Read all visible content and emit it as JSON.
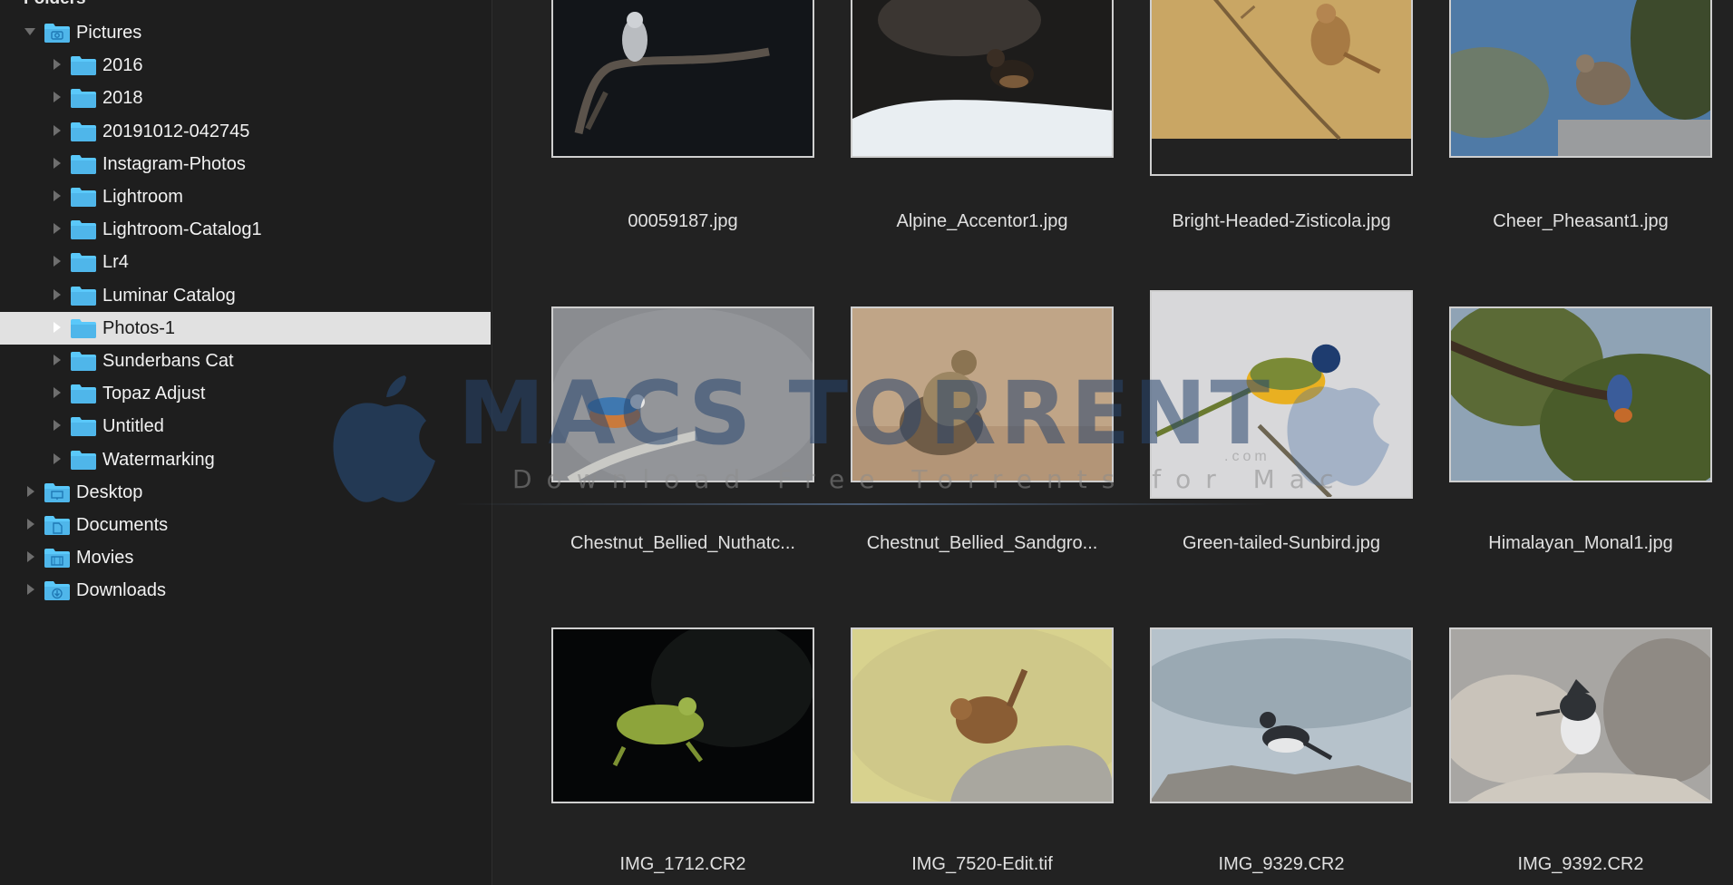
{
  "sidebar": {
    "section_title": "Folders",
    "tree": [
      {
        "label": "Pictures",
        "level": 0,
        "expanded": true,
        "icon": "pictures-folder-icon"
      },
      {
        "label": "2016",
        "level": 1,
        "icon": "folder-icon"
      },
      {
        "label": "2018",
        "level": 1,
        "icon": "folder-icon"
      },
      {
        "label": "20191012-042745",
        "level": 1,
        "icon": "folder-icon"
      },
      {
        "label": "Instagram-Photos",
        "level": 1,
        "icon": "folder-icon"
      },
      {
        "label": "Lightroom",
        "level": 1,
        "icon": "folder-icon"
      },
      {
        "label": "Lightroom-Catalog1",
        "level": 1,
        "icon": "folder-icon"
      },
      {
        "label": "Lr4",
        "level": 1,
        "icon": "folder-icon"
      },
      {
        "label": "Luminar Catalog",
        "level": 1,
        "icon": "folder-icon"
      },
      {
        "label": "Photos-1",
        "level": 1,
        "selected": true,
        "icon": "folder-icon"
      },
      {
        "label": "Sunderbans Cat",
        "level": 1,
        "icon": "folder-icon"
      },
      {
        "label": "Topaz Adjust",
        "level": 1,
        "icon": "folder-icon"
      },
      {
        "label": "Untitled",
        "level": 1,
        "icon": "folder-icon"
      },
      {
        "label": "Watermarking",
        "level": 1,
        "icon": "folder-icon"
      },
      {
        "label": "Desktop",
        "level": 0,
        "icon": "desktop-folder-icon"
      },
      {
        "label": "Documents",
        "level": 0,
        "icon": "documents-folder-icon"
      },
      {
        "label": "Movies",
        "level": 0,
        "icon": "movies-folder-icon"
      },
      {
        "label": "Downloads",
        "level": 0,
        "icon": "downloads-folder-icon"
      }
    ]
  },
  "grid": {
    "items": [
      {
        "filename": "00059187.jpg",
        "scene": "night-branch"
      },
      {
        "filename": "Alpine_Accentor1.jpg",
        "scene": "snow"
      },
      {
        "filename": "Bright-Headed-Zisticola.jpg",
        "scene": "golden"
      },
      {
        "filename": "Cheer_Pheasant1.jpg",
        "scene": "forest-sky"
      },
      {
        "filename": "Chestnut_Bellied_Nuthatc...",
        "scene": "grey-branch"
      },
      {
        "filename": "Chestnut_Bellied_Sandgro...",
        "scene": "sand"
      },
      {
        "filename": "Green-tailed-Sunbird.jpg",
        "scene": "pale-grey"
      },
      {
        "filename": "Himalayan_Monal1.jpg",
        "scene": "tree"
      },
      {
        "filename": "IMG_1712.CR2",
        "scene": "dark-frog"
      },
      {
        "filename": "IMG_7520-Edit.tif",
        "scene": "yellow-rock"
      },
      {
        "filename": "IMG_9329.CR2",
        "scene": "river"
      },
      {
        "filename": "IMG_9392.CR2",
        "scene": "rock-grey"
      }
    ]
  },
  "watermark": {
    "title": "MACS TORRENT",
    "subtitle": "Download Free Torrents for Mac",
    "domain": ".com"
  },
  "colors": {
    "sidebar_bg": "#1e1e1e",
    "grid_bg": "#222222",
    "selection": "#e1e1e1",
    "folder_blue": "#5ac8fa"
  }
}
